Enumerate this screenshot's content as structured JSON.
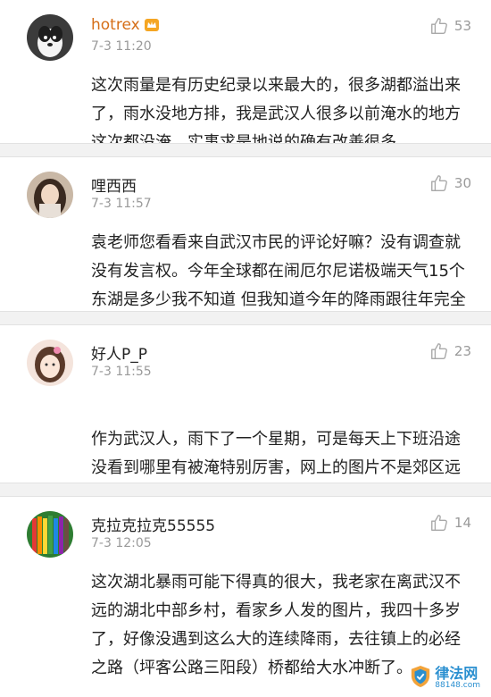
{
  "comments": [
    {
      "username": "hotrex",
      "has_vip_badge": true,
      "time": "7-3 11:20",
      "likes": "53",
      "text": "这次雨量是有历史纪录以来最大的，很多湖都溢出来了，雨水没地方排，我是武汉人很多以前淹水的地方这次都没淹，实事求是地说的确有改善很多"
    },
    {
      "username": "哩西西",
      "has_vip_badge": false,
      "time": "7-3 11:57",
      "likes": "30",
      "text": "袁老师您看看来自武汉市民的评论好嘛？没有调查就没有发言权。今年全球都在闹厄尔尼诺极端天气15个东湖是多少我不知道 但我知道今年的降雨跟往年完全不是一个级别的"
    },
    {
      "username": "好人P_P",
      "has_vip_badge": false,
      "time": "7-3 11:55",
      "likes": "23",
      "text": "作为武汉人，雨下了一个星期，可是每天上下班沿途没看到哪里有被淹特别厉害，网上的图片不是郊区远城区就是以前的图片，再换句话说，这么大的雨量，换哪个城市也扛不住",
      "emojis": [
        "sweat-smile-emoji",
        "sweat-smile-emoji"
      ]
    },
    {
      "username": "克拉克拉克55555",
      "has_vip_badge": false,
      "time": "7-3 12:05",
      "likes": "14",
      "text": "这次湖北暴雨可能下得真的很大，我老家在离武汉不远的湖北中部乡村，看家乡人发的图片，我四十多岁了，好像没遇到这么大的连续降雨，去往镇上的必经之路（坪客公路三阳段）桥都给大水冲断了。"
    }
  ],
  "watermark": {
    "title": "律法网",
    "url": "88148.com"
  },
  "colors": {
    "vip_username": "#d56e17",
    "meta_gray": "#9a9a9a",
    "divider": "#f2f2f2"
  }
}
